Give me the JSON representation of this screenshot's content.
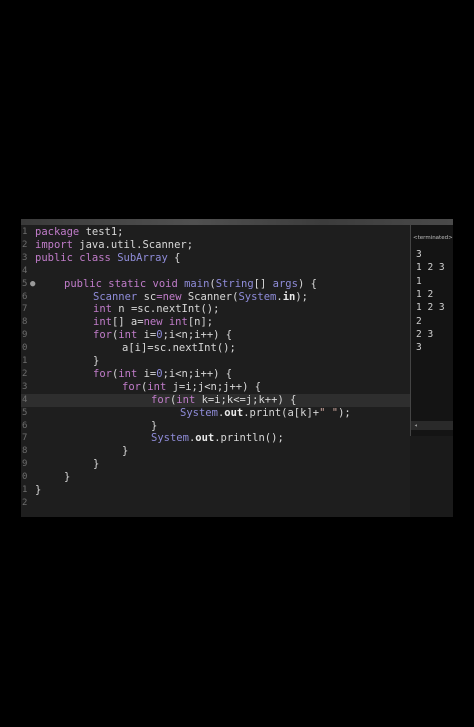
{
  "editor": {
    "lines": [
      {
        "num": "1",
        "marker": "",
        "indent": 0,
        "tokens": [
          [
            "kw",
            "package "
          ],
          [
            "tx",
            "test1;"
          ]
        ]
      },
      {
        "num": "2",
        "marker": "",
        "indent": 0,
        "tokens": [
          [
            "kw",
            "import "
          ],
          [
            "tx",
            "java.util.Scanner;"
          ]
        ]
      },
      {
        "num": "3",
        "marker": "",
        "indent": 0,
        "tokens": [
          [
            "kw",
            "public class "
          ],
          [
            "cls",
            "SubArray"
          ],
          [
            "tx",
            " {"
          ]
        ]
      },
      {
        "num": "4",
        "marker": "",
        "indent": 0,
        "tokens": []
      },
      {
        "num": "5",
        "marker": "●",
        "indent": 1,
        "tokens": [
          [
            "kw",
            "public static void "
          ],
          [
            "cls",
            "main"
          ],
          [
            "tx",
            "("
          ],
          [
            "cls",
            "String"
          ],
          [
            "tx",
            "[] "
          ],
          [
            "cls",
            "args"
          ],
          [
            "tx",
            ") {"
          ]
        ]
      },
      {
        "num": "6",
        "marker": "",
        "indent": 2,
        "tokens": [
          [
            "cls",
            "Scanner "
          ],
          [
            "tx",
            "sc"
          ],
          [
            "kw",
            "="
          ],
          [
            "kw",
            "new "
          ],
          [
            "tx",
            "Scanner("
          ],
          [
            "cls",
            "System"
          ],
          [
            "tx",
            "."
          ],
          [
            "fld",
            "in"
          ],
          [
            "tx",
            ");"
          ]
        ]
      },
      {
        "num": "7",
        "marker": "",
        "indent": 2,
        "tokens": [
          [
            "kw",
            "int "
          ],
          [
            "tx",
            "n =sc.nextInt();"
          ]
        ]
      },
      {
        "num": "8",
        "marker": "",
        "indent": 2,
        "tokens": [
          [
            "kw",
            "int"
          ],
          [
            "tx",
            "[] a="
          ],
          [
            "kw",
            "new int"
          ],
          [
            "tx",
            "[n];"
          ]
        ]
      },
      {
        "num": "9",
        "marker": "",
        "indent": 2,
        "tokens": [
          [
            "kw",
            "for"
          ],
          [
            "tx",
            "("
          ],
          [
            "kw",
            "int "
          ],
          [
            "tx",
            "i="
          ],
          [
            "cls",
            "0"
          ],
          [
            "tx",
            ";i<n;i++) {"
          ]
        ]
      },
      {
        "num": "0",
        "marker": "",
        "indent": 3,
        "tokens": [
          [
            "tx",
            "a[i]=sc.nextInt();"
          ]
        ]
      },
      {
        "num": "1",
        "marker": "",
        "indent": 2,
        "tokens": [
          [
            "tx",
            "}"
          ]
        ]
      },
      {
        "num": "2",
        "marker": "",
        "indent": 2,
        "tokens": [
          [
            "kw",
            "for"
          ],
          [
            "tx",
            "("
          ],
          [
            "kw",
            "int "
          ],
          [
            "tx",
            "i="
          ],
          [
            "cls",
            "0"
          ],
          [
            "tx",
            ";i<n;i++) {"
          ]
        ]
      },
      {
        "num": "3",
        "marker": "",
        "indent": 3,
        "tokens": [
          [
            "kw",
            "for"
          ],
          [
            "tx",
            "("
          ],
          [
            "kw",
            "int "
          ],
          [
            "tx",
            "j=i;j<n;j++) {"
          ]
        ]
      },
      {
        "num": "4",
        "marker": "",
        "indent": 4,
        "tokens": [
          [
            "kw",
            "for"
          ],
          [
            "tx",
            "("
          ],
          [
            "kw",
            "int "
          ],
          [
            "tx",
            "k=i;k<=j;k++) {"
          ]
        ]
      },
      {
        "num": "5",
        "marker": "",
        "indent": 5,
        "tokens": [
          [
            "cls",
            "System"
          ],
          [
            "tx",
            "."
          ],
          [
            "fld",
            "out"
          ],
          [
            "tx",
            ".print(a[k]+"
          ],
          [
            "str",
            "\" \""
          ],
          [
            "tx",
            ");"
          ]
        ]
      },
      {
        "num": "6",
        "marker": "",
        "indent": 4,
        "tokens": [
          [
            "tx",
            "}"
          ]
        ]
      },
      {
        "num": "7",
        "marker": "",
        "indent": 4,
        "tokens": [
          [
            "cls",
            "System"
          ],
          [
            "tx",
            "."
          ],
          [
            "fld",
            "out"
          ],
          [
            "tx",
            ".println();"
          ]
        ]
      },
      {
        "num": "8",
        "marker": "",
        "indent": 3,
        "tokens": [
          [
            "tx",
            "}"
          ]
        ]
      },
      {
        "num": "9",
        "marker": "",
        "indent": 2,
        "tokens": [
          [
            "tx",
            "}"
          ]
        ]
      },
      {
        "num": "0",
        "marker": "",
        "indent": 1,
        "tokens": [
          [
            "tx",
            "}"
          ]
        ]
      },
      {
        "num": "1",
        "marker": "",
        "indent": 0,
        "tokens": [
          [
            "tx",
            "}"
          ]
        ]
      },
      {
        "num": "2",
        "marker": "",
        "indent": 0,
        "tokens": []
      }
    ]
  },
  "console": {
    "header": "<terminated>",
    "output": [
      "3",
      "1 2 3",
      "1",
      "1 2",
      "1 2 3",
      "2",
      "2 3",
      "3"
    ]
  }
}
